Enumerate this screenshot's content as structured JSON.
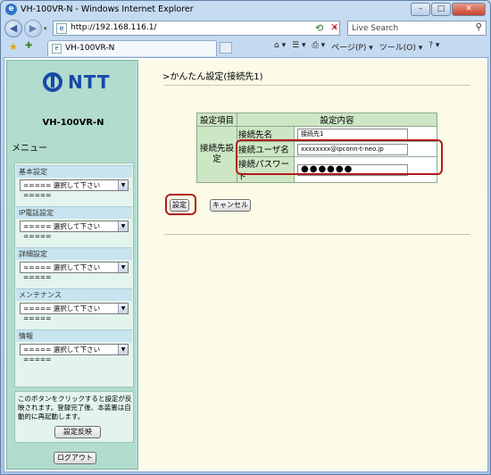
{
  "window": {
    "title": "VH-100VR-N - Windows Internet Explorer",
    "minimize": "–",
    "maximize": "□",
    "close": "✕"
  },
  "address_bar": {
    "url": "http://192.168.116.1/",
    "refresh": "⟲",
    "stop": "✕"
  },
  "search": {
    "placeholder": "Live Search",
    "icon": "⚲"
  },
  "tab": {
    "label": "VH-100VR-N"
  },
  "toolbar": {
    "home": "⌂ ▾",
    "feeds": "☰ ▾",
    "print": "⎙ ▾",
    "page": "ページ(P) ▾",
    "tools": "ツール(O) ▾",
    "help": "? ▾"
  },
  "sidebar": {
    "brand": "NTT",
    "model": "VH-100VR-N",
    "menu_title": "メニュー",
    "sections": [
      {
        "heading": "基本設定",
        "select": "===== 選択して下さい ====="
      },
      {
        "heading": "IP電話設定",
        "select": "===== 選択して下さい ====="
      },
      {
        "heading": "詳細設定",
        "select": "===== 選択して下さい ====="
      },
      {
        "heading": "メンテナンス",
        "select": "===== 選択して下さい ====="
      },
      {
        "heading": "情報",
        "select": "===== 選択して下さい ====="
      }
    ],
    "apply_desc": "このボタンをクリックすると設定が反映されます。登録完了後、本装置は自動的に再起動します。",
    "apply_button": "設定反映",
    "logout_button": "ログアウト"
  },
  "main": {
    "page_title": ">かんたん設定(接続先1)",
    "table": {
      "header_item": "設定項目",
      "header_content": "設定内容",
      "group_label": "接続先設定",
      "rows": [
        {
          "label": "接続先名",
          "value": "接続先1"
        },
        {
          "label": "接続ユーザ名",
          "value": "xxxxxxxx@ipconn-t-neo.jp"
        },
        {
          "label": "接続パスワード",
          "value": "●●●●●●"
        }
      ]
    },
    "set_button": "設定",
    "cancel_button": "キャンセル"
  },
  "colors": {
    "sidebar_bg": "#b2dccd",
    "main_bg": "#fbfbe7",
    "table_header": "#cde6c4",
    "highlight": "#b31b1b",
    "brand": "#1848a8"
  }
}
